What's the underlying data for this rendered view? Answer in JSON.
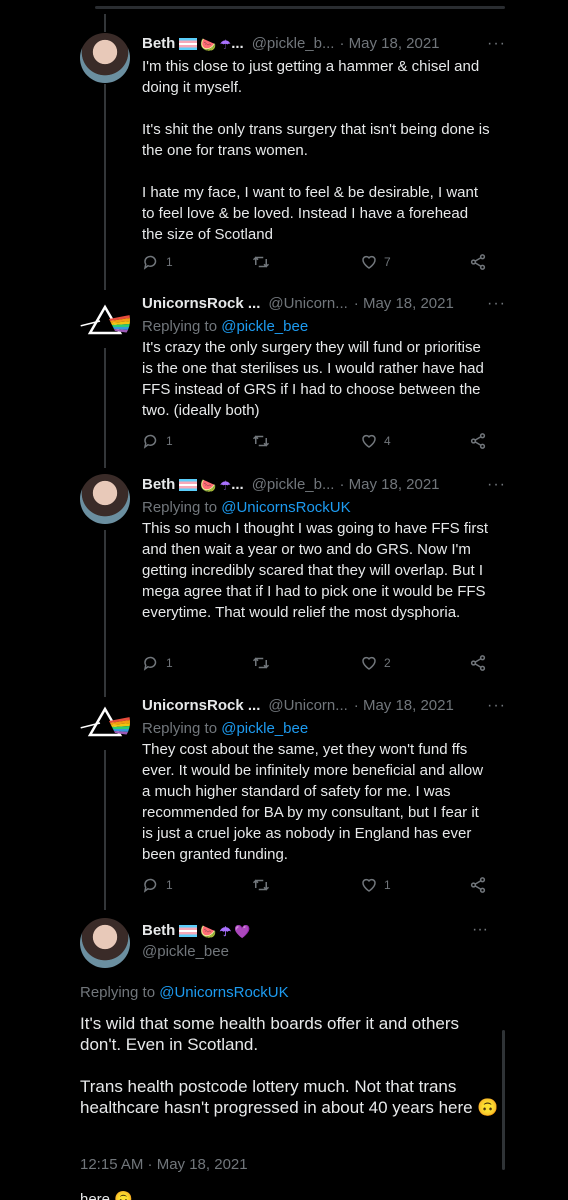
{
  "replies": [
    {
      "name": "Beth",
      "handle": "@pickle_b...",
      "date": "· May 18, 2021",
      "reply_to_prefix": "",
      "reply_to_user": "",
      "text": "I'm this close to just getting a hammer & chisel and doing it myself.\n\nIt's shit the only trans surgery that isn't being done is the one for trans women.\n\nI hate my face, I want to feel & be desirable, I want to feel love & be loved. Instead I have a forehead the size of Scotland",
      "replies_count": "1",
      "retweets_count": "",
      "likes_count": "7"
    },
    {
      "name": "UnicornsRock ...",
      "handle": "@Unicorn...",
      "date": "· May 18, 2021",
      "reply_to_prefix": "Replying to ",
      "reply_to_user": "@pickle_bee",
      "text": "It's crazy the only surgery they will fund or prioritise is the one that sterilises us. I would rather have had FFS instead of GRS if I had to choose between the two. (ideally both)",
      "replies_count": "1",
      "retweets_count": "",
      "likes_count": "4"
    },
    {
      "name": "Beth",
      "handle": "@pickle_b...",
      "date": "· May 18, 2021",
      "reply_to_prefix": "Replying to ",
      "reply_to_user": "@UnicornsRockUK",
      "text": "This so much I thought I was going to have FFS first and then wait a year or two and do GRS. Now I'm getting incredibly scared that they will overlap. But I mega agree that if I had to pick one it would be FFS everytime. That would relief the most dysphoria.",
      "replies_count": "1",
      "retweets_count": "",
      "likes_count": "2"
    },
    {
      "name": "UnicornsRock ...",
      "handle": "@Unicorn...",
      "date": "· May 18, 2021",
      "reply_to_prefix": "Replying to ",
      "reply_to_user": "@pickle_bee",
      "text": "They cost about the same, yet they won't fund ffs ever. It would be infinitely more beneficial and allow a much higher standard of safety for me. I was recommended for BA by my consultant, but I fear it is just a cruel joke as nobody in England has ever been granted funding.",
      "replies_count": "1",
      "retweets_count": "",
      "likes_count": "1"
    }
  ],
  "main": {
    "name": "Beth",
    "handle": "@pickle_bee",
    "reply_to_prefix": "Replying to ",
    "reply_to_user": "@UnicornsRockUK",
    "text": "It's wild that some health boards offer it and others don't. Even in Scotland.\n\nTrans health postcode lottery much. Not that trans healthcare hasn't progressed in about 40 years here 🙃",
    "timestamp": "12:15 AM · May 18, 2021",
    "cutoff_text": "here 🙃"
  },
  "ui": {
    "more_label": "···",
    "emoji_watermelon": "🍉",
    "emoji_umbrella": "☂",
    "emoji_heart": "💜",
    "ellipsis": "...",
    "accent": "#1d9bf0",
    "muted": "#71767b"
  }
}
